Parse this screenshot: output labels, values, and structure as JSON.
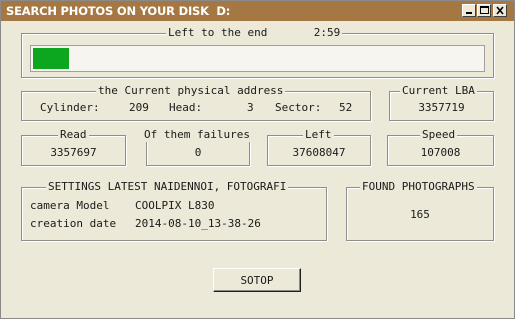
{
  "window": {
    "title": "SEARCH PHOTOS ON YOUR DISK  D:",
    "controls": {
      "minimize_icon": "minimize-icon",
      "maximize_icon": "maximize-icon",
      "close_icon": "close-icon"
    }
  },
  "progress": {
    "label": "Left to the end",
    "time_left": "2:59",
    "fraction": 0.08,
    "fill_color": "#0ca61f"
  },
  "address": {
    "label": "the Current physical address",
    "cylinder_label": "Cylinder",
    "cylinder_value": "209",
    "head_label": "Head:",
    "head_value": "3",
    "sector_label": "Sector:",
    "sector_value": "52"
  },
  "lba": {
    "label": "Current LBA",
    "value": "3357719"
  },
  "read": {
    "label": "Read",
    "value": "3357697"
  },
  "failures": {
    "label": "Of them failures",
    "value": "0"
  },
  "left": {
    "label": "Left",
    "value": "37608047"
  },
  "speed": {
    "label": "Speed",
    "value": "107008"
  },
  "settings": {
    "label": "SETTINGS LATEST NAIDENNOI, FOTOGRAFI",
    "camera_label": "camera Model",
    "camera_value": "COOLPIX L830",
    "date_label": "creation date",
    "date_value": "2014-08-10_13-38-26"
  },
  "found": {
    "label": "FOUND PHOTOGRAPHS",
    "value": "165"
  },
  "stop_button": {
    "label": "SOTOP"
  },
  "colors": {
    "titlebar": "#a57742",
    "background": "#ece9d8"
  }
}
